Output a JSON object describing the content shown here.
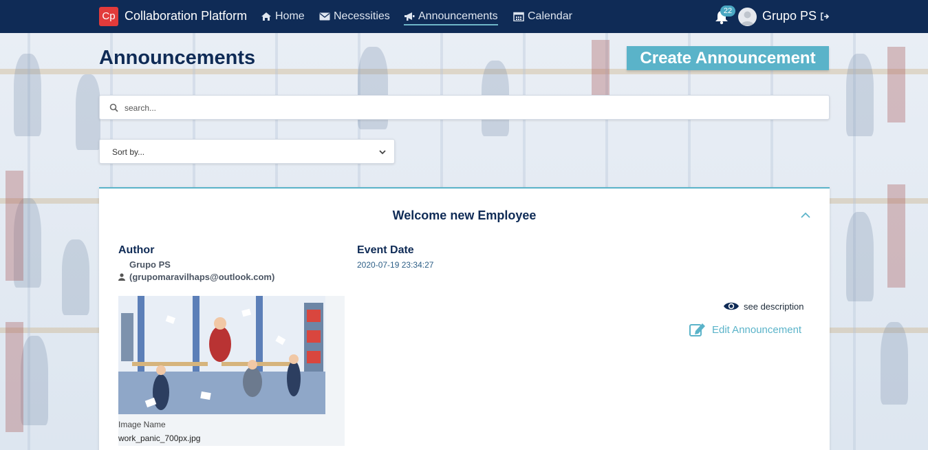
{
  "navbar": {
    "brand_logo": "Cp",
    "brand_name": "Collaboration Platform",
    "items": [
      {
        "label": "Home",
        "icon": "home-icon"
      },
      {
        "label": "Necessities",
        "icon": "envelope-icon"
      },
      {
        "label": "Announcements",
        "icon": "megaphone-icon",
        "active": true
      },
      {
        "label": "Calendar",
        "icon": "calendar-icon"
      }
    ],
    "notification_count": "22",
    "user_name": "Grupo PS"
  },
  "page": {
    "title": "Announcements",
    "create_button": "Create Announcement"
  },
  "search": {
    "placeholder": "search...",
    "value": ""
  },
  "sort": {
    "selected": "Sort by..."
  },
  "announcement": {
    "title": "Welcome new Employee",
    "author_label": "Author",
    "author_name": "Grupo PS",
    "author_email": "(grupomaravilhaps@outlook.com)",
    "date_label": "Event Date",
    "event_date": "2020-07-19 23:34:27",
    "image_name_label": "Image Name",
    "image_name": "work_panic_700px.jpg",
    "see_description": "see description",
    "edit_label": "Edit Announcement"
  },
  "colors": {
    "navbar": "#0f2b56",
    "accent": "#5ab3c9",
    "logo": "#e23b3b"
  }
}
